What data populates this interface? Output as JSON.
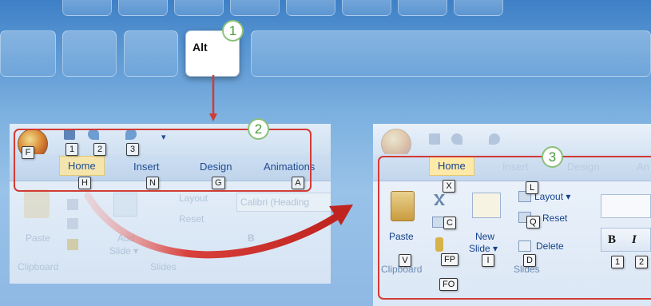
{
  "keyboard": {
    "alt_key_label": "Alt"
  },
  "steps": [
    "1",
    "2",
    "3"
  ],
  "ribbon_before": {
    "office_keytip": "F",
    "qat_keytips": [
      "1",
      "2",
      "3"
    ],
    "tabs": [
      {
        "label": "Home",
        "keytip": "H"
      },
      {
        "label": "Insert",
        "keytip": "N"
      },
      {
        "label": "Design",
        "keytip": "G"
      },
      {
        "label": "Animations",
        "keytip": "A"
      }
    ],
    "faded": {
      "paste": "Paste",
      "clipboard": "Clipboard",
      "add_slide": "Add",
      "slide_dd": "Slide ▾",
      "layout": "Layout",
      "reset": "Reset",
      "font": "Calibri (Heading",
      "slides": "Slides",
      "bold": "B"
    }
  },
  "ribbon_after": {
    "tabs": [
      {
        "label": "Home"
      },
      {
        "label": "Insert"
      },
      {
        "label": "Design"
      },
      {
        "label": "An"
      }
    ],
    "buttons": {
      "paste": "Paste",
      "clipboard": "Clipboard",
      "new": "New",
      "slide": "Slide ▾",
      "layout": "Layout ▾",
      "reset": "Reset",
      "delete": "Delete",
      "slides": "Slides",
      "bold": "B",
      "italic": "I"
    },
    "keytips": {
      "paste": "V",
      "cut": "X",
      "copy": "C",
      "format_painter": "FP",
      "clipboard_launcher": "FO",
      "layout": "L",
      "reset": "Q",
      "new_slide": "I",
      "delete": "D",
      "font_1": "1",
      "font_2": "2"
    }
  },
  "colors": {
    "highlight": "#d23b35",
    "step_green": "#4a9a3b",
    "tab_text": "#15428b"
  }
}
